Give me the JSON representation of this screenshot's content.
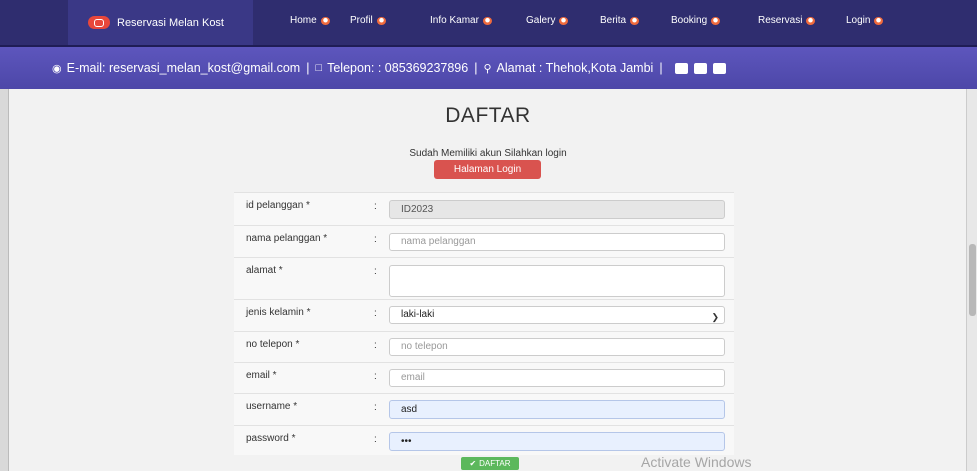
{
  "nav": {
    "brand": "Reservasi Melan Kost",
    "items": [
      "Home",
      "Profil",
      "Info Kamar",
      "Galery",
      "Berita",
      "Booking",
      "Reservasi",
      "Login"
    ]
  },
  "contact": {
    "email": "E-mail: reservasi_melan_kost@gmail.com",
    "phone": "Telepon: : 085369237896",
    "address": "Alamat : Thehok,Kota Jambi"
  },
  "page": {
    "title": "DAFTAR",
    "login_prompt": "Sudah Memiliki akun Silahkan login",
    "login_button": "Halaman Login"
  },
  "form": {
    "colon": ":",
    "id_label": "id pelanggan *",
    "id_value": "ID2023",
    "nama_label": "nama pelanggan *",
    "nama_placeholder": "nama pelanggan",
    "alamat_label": "alamat *",
    "jk_label": "jenis kelamin *",
    "jk_value": "laki-laki",
    "telp_label": "no telepon *",
    "telp_placeholder": "no telepon",
    "email_label": "email *",
    "email_placeholder": "email",
    "username_label": "username *",
    "username_value": "asd",
    "password_label": "password *",
    "password_value": "•••",
    "submit": "DAFTAR"
  },
  "watermark": "Activate Windows",
  "colors": {
    "navbar": "#2f2d6f",
    "topbar": "#5650b5",
    "danger": "#d9534f",
    "success": "#5cb85c"
  }
}
